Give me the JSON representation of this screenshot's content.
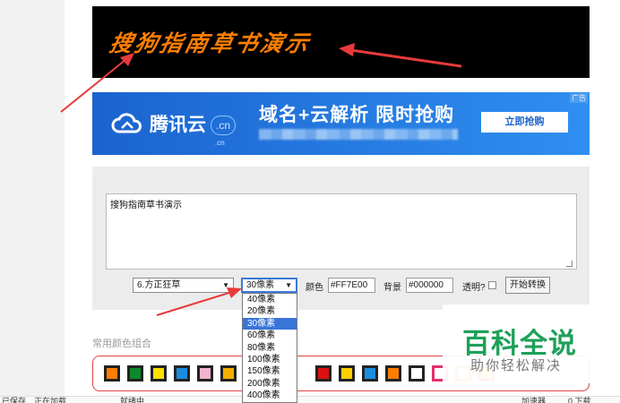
{
  "preview": {
    "text": "搜狗指南草书演示",
    "color": "#ff7e00",
    "background": "#000000"
  },
  "ad": {
    "brand": "腾讯云",
    "cn_badge": ".cn",
    "cn_sub": ".cn",
    "headline": "域名+云解析 限时抢购",
    "button": "立即抢购",
    "tag": "广告"
  },
  "editor": {
    "text": "搜狗指南草书演示"
  },
  "controls": {
    "font_value": "6.方正狂草",
    "size_value": "30像素",
    "color_label": "颜色",
    "color_value": "#FF7E00",
    "bg_label": "背景",
    "bg_value": "#000000",
    "transparent_label": "透明?",
    "convert_button": "开始转换"
  },
  "size_options": [
    "40像素",
    "20像素",
    "30像素",
    "60像素",
    "80像素",
    "100像素",
    "150像素",
    "200像素",
    "400像素"
  ],
  "size_selected_index": 2,
  "colors": {
    "section_title": "常用颜色组合",
    "swatches": [
      {
        "border": "#222222",
        "fill": "#ff7e00"
      },
      {
        "border": "#222222",
        "fill": "#0a8a2a"
      },
      {
        "border": "#222222",
        "fill": "#ffe000"
      },
      {
        "border": "#222222",
        "fill": "#1a8de0"
      },
      {
        "border": "#222222",
        "fill": "#f3b3d0"
      },
      {
        "border": "#222222",
        "fill": "#f3b000"
      },
      {
        "border": "#222222",
        "fill": "#dd1111"
      },
      {
        "border": "#222222",
        "fill": "#ffd000"
      },
      {
        "border": "#222222",
        "fill": "#1a8de0"
      },
      {
        "border": "#222222",
        "fill": "#ff7e00"
      },
      {
        "border": "#222222",
        "fill": "#ffffff"
      },
      {
        "border": "#e0306e",
        "fill": "#ffffff"
      },
      {
        "border": "#f08a00",
        "fill": "#ffffff"
      },
      {
        "border": "#e0306e",
        "fill": "#ffe000"
      }
    ]
  },
  "watermark": {
    "main": "百科全说",
    "sub": "助你轻松解决"
  },
  "statusbar": {
    "left1": "已保存",
    "left2": "正在加载",
    "left3": "就绪中",
    "right1": "加速器",
    "right2": "0 下载"
  },
  "accent": "#3875d7"
}
